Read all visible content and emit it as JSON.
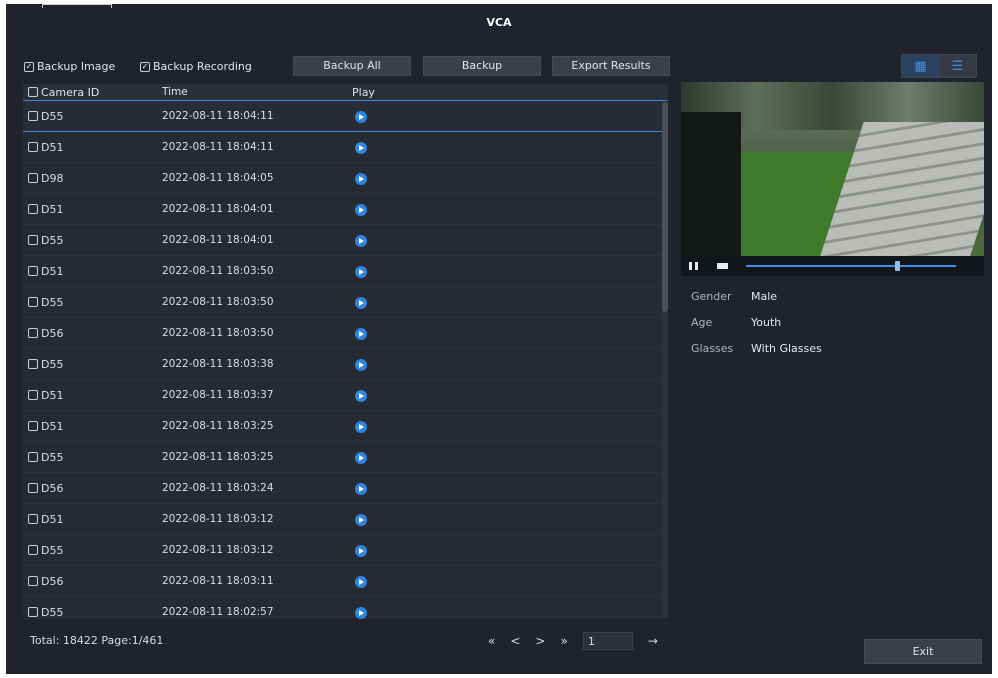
{
  "window": {
    "title": "VCA"
  },
  "toolbar": {
    "backup_image_label": "Backup Image",
    "backup_image_checked": true,
    "backup_recording_label": "Backup Recording",
    "backup_recording_checked": true,
    "backup_all_label": "Backup All",
    "backup_label": "Backup",
    "export_label": "Export Results",
    "view_modes": [
      "grid-view-icon",
      "list-view-icon"
    ]
  },
  "table": {
    "columns": {
      "camera_id": "Camera ID",
      "time": "Time",
      "play": "Play"
    },
    "rows": [
      {
        "camera": "D55",
        "time": "2022-08-11 18:04:11"
      },
      {
        "camera": "D51",
        "time": "2022-08-11 18:04:11"
      },
      {
        "camera": "D98",
        "time": "2022-08-11 18:04:05"
      },
      {
        "camera": "D51",
        "time": "2022-08-11 18:04:01"
      },
      {
        "camera": "D55",
        "time": "2022-08-11 18:04:01"
      },
      {
        "camera": "D51",
        "time": "2022-08-11 18:03:50"
      },
      {
        "camera": "D55",
        "time": "2022-08-11 18:03:50"
      },
      {
        "camera": "D56",
        "time": "2022-08-11 18:03:50"
      },
      {
        "camera": "D55",
        "time": "2022-08-11 18:03:38"
      },
      {
        "camera": "D51",
        "time": "2022-08-11 18:03:37"
      },
      {
        "camera": "D51",
        "time": "2022-08-11 18:03:25"
      },
      {
        "camera": "D55",
        "time": "2022-08-11 18:03:25"
      },
      {
        "camera": "D56",
        "time": "2022-08-11 18:03:24"
      },
      {
        "camera": "D51",
        "time": "2022-08-11 18:03:12"
      },
      {
        "camera": "D55",
        "time": "2022-08-11 18:03:12"
      },
      {
        "camera": "D56",
        "time": "2022-08-11 18:03:11"
      },
      {
        "camera": "D55",
        "time": "2022-08-11 18:02:57"
      }
    ]
  },
  "details": {
    "gender_label": "Gender",
    "gender_value": "Male",
    "age_label": "Age",
    "age_value": "Youth",
    "glasses_label": "Glasses",
    "glasses_value": "With Glasses"
  },
  "player": {
    "progress": 0.72
  },
  "footer": {
    "total": "Total: 18422",
    "page": "Page:1/461",
    "first": "«",
    "prev": "<",
    "next": ">",
    "last": "»",
    "page_input": "1",
    "go": "→",
    "exit_label": "Exit"
  },
  "colors": {
    "accent": "#3f8fe8",
    "background": "#20232b",
    "panel": "#262a33"
  }
}
